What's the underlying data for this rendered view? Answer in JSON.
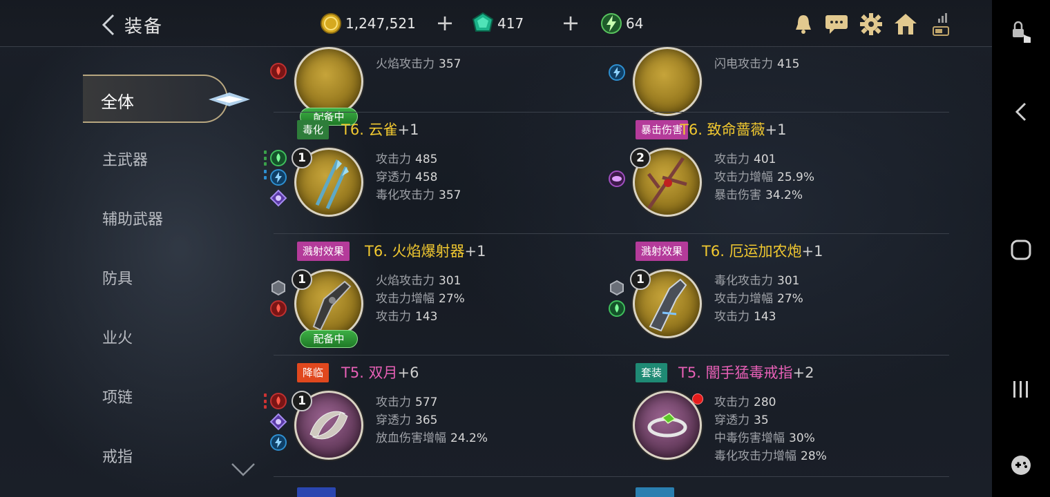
{
  "header": {
    "title": "装备",
    "gold": "1,247,521",
    "gems": "417",
    "energy": "64"
  },
  "sidebar": {
    "active": "全体",
    "items": [
      "主武器",
      "辅助武器",
      "防具",
      "业火",
      "项链",
      "戒指"
    ]
  },
  "partial_top": {
    "left": {
      "stat_name": "火焰攻击力",
      "stat_value": "357",
      "equipped": "配备中"
    },
    "right": {
      "stat_name": "闪电攻击力",
      "stat_value": "415"
    }
  },
  "items": [
    {
      "tag": "毒化",
      "tag_color": "#2e7d3a",
      "name": "T6. 云雀",
      "level": "+1",
      "name_color": "#f2c930",
      "badge": "1",
      "bg": "gold",
      "equipped": "",
      "stats": [
        [
          "攻击力",
          "485"
        ],
        [
          "穿透力",
          "458"
        ],
        [
          "毒化攻击力",
          "357"
        ]
      ]
    },
    {
      "tag": "暴击伤害",
      "tag_color": "#b43b9a",
      "name": "T6. 致命蔷薇",
      "level": "+1",
      "name_color": "#f2c930",
      "badge": "2",
      "bg": "gold",
      "equipped": "",
      "stats": [
        [
          "攻击力",
          "401"
        ],
        [
          "攻击力增幅",
          "25.9%"
        ],
        [
          "暴击伤害",
          "34.2%"
        ]
      ]
    },
    {
      "tag": "溅射效果",
      "tag_color": "#b43b9a",
      "name": "T6. 火焰爆射器",
      "level": "+1",
      "name_color": "#f2c930",
      "badge": "1",
      "bg": "gold",
      "equipped": "配备中",
      "stats": [
        [
          "火焰攻击力",
          "301"
        ],
        [
          "攻击力增幅",
          "27%"
        ],
        [
          "攻击力",
          "143"
        ]
      ]
    },
    {
      "tag": "溅射效果",
      "tag_color": "#b43b9a",
      "name": "T6. 厄运加农炮",
      "level": "+1",
      "name_color": "#f2c930",
      "badge": "1",
      "bg": "gold",
      "equipped": "",
      "stats": [
        [
          "毒化攻击力",
          "301"
        ],
        [
          "攻击力增幅",
          "27%"
        ],
        [
          "攻击力",
          "143"
        ]
      ]
    },
    {
      "tag": "降临",
      "tag_color": "#e0481e",
      "name": "T5. 双月",
      "level": "+6",
      "name_color": "#e760b6",
      "badge": "1",
      "bg": "purple",
      "equipped": "",
      "stats": [
        [
          "攻击力",
          "577"
        ],
        [
          "穿透力",
          "365"
        ],
        [
          "放血伤害增幅",
          "24.2%"
        ]
      ]
    },
    {
      "tag": "套装",
      "tag_color": "#1f8a74",
      "name": "T5. 闇手猛毒戒指",
      "level": "+2",
      "name_color": "#e760b6",
      "badge": "",
      "bg": "purple",
      "equipped": "",
      "new_dot": true,
      "stats": [
        [
          "攻击力",
          "280"
        ],
        [
          "穿透力",
          "35"
        ],
        [
          "中毒伤害增幅",
          "30%"
        ],
        [
          "毒化攻击力增幅",
          "28%"
        ]
      ]
    }
  ]
}
